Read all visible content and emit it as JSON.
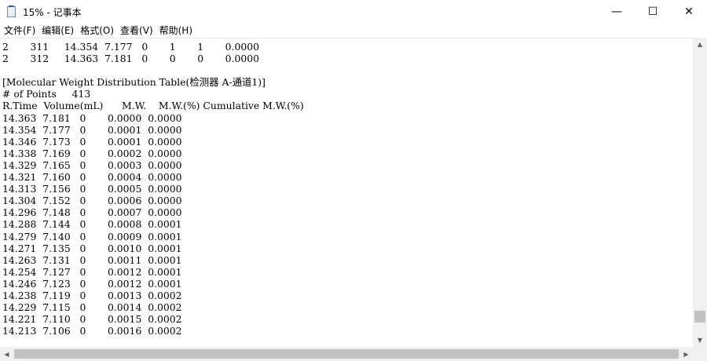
{
  "window": {
    "title": "15% - 记事本",
    "controls": {
      "minimize": "—",
      "maximize": "☐",
      "close": "✕"
    }
  },
  "menu": {
    "items": [
      "文件(F)",
      "编辑(E)",
      "格式(O)",
      "查看(V)",
      "帮助(H)"
    ]
  },
  "document": {
    "lines": [
      "2       311     14.354  7.177   0       1       1       0.0000",
      "2       312     14.363  7.181   0       0       0       0.0000",
      "",
      "[Molecular Weight Distribution Table(检测器 A-通道1)]",
      "# of Points     413",
      "R.Time  Volume(mL)      M.W.    M.W.(%) Cumulative M.W.(%)",
      "14.363  7.181   0       0.0000  0.0000",
      "14.354  7.177   0       0.0001  0.0000",
      "14.346  7.173   0       0.0001  0.0000",
      "14.338  7.169   0       0.0002  0.0000",
      "14.329  7.165   0       0.0003  0.0000",
      "14.321  7.160   0       0.0004  0.0000",
      "14.313  7.156   0       0.0005  0.0000",
      "14.304  7.152   0       0.0006  0.0000",
      "14.296  7.148   0       0.0007  0.0000",
      "14.288  7.144   0       0.0008  0.0001",
      "14.279  7.140   0       0.0009  0.0001",
      "14.271  7.135   0       0.0010  0.0001",
      "14.263  7.131   0       0.0011  0.0001",
      "14.254  7.127   0       0.0012  0.0001",
      "14.246  7.123   0       0.0012  0.0001",
      "14.238  7.119   0       0.0013  0.0002",
      "14.229  7.115   0       0.0014  0.0002",
      "14.221  7.110   0       0.0015  0.0002",
      "14.213  7.106   0       0.0016  0.0002"
    ]
  },
  "scrollbars": {
    "up_arrow": "▲",
    "down_arrow": "▼",
    "left_arrow": "◀",
    "right_arrow": "▶"
  }
}
